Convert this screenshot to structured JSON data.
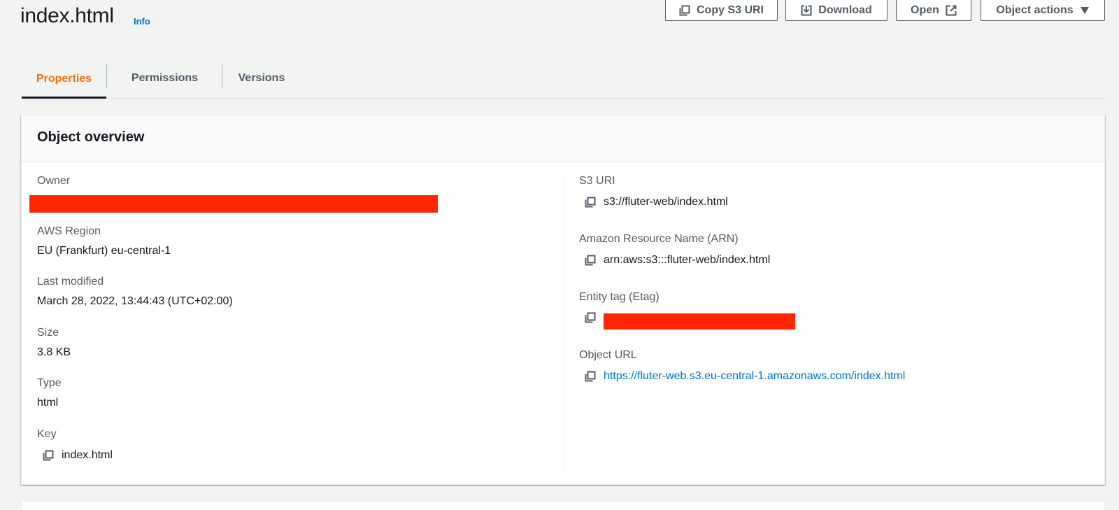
{
  "page": {
    "title": "index.html",
    "info_link": "Info"
  },
  "actions": {
    "copy_s3_uri": "Copy S3 URI",
    "download": "Download",
    "open": "Open",
    "object_actions": "Object actions"
  },
  "tabs": [
    {
      "label": "Properties",
      "active": true
    },
    {
      "label": "Permissions",
      "active": false
    },
    {
      "label": "Versions",
      "active": false
    }
  ],
  "overview": {
    "title": "Object overview",
    "left": {
      "owner": {
        "label": "Owner",
        "value": "[redacted]"
      },
      "region": {
        "label": "AWS Region",
        "value": "EU (Frankfurt) eu-central-1"
      },
      "last_modified": {
        "label": "Last modified",
        "value": "March 28, 2022, 13:44:43 (UTC+02:00)"
      },
      "size": {
        "label": "Size",
        "value": "3.8 KB"
      },
      "type": {
        "label": "Type",
        "value": "html"
      },
      "key": {
        "label": "Key",
        "value": "index.html"
      }
    },
    "right": {
      "s3_uri": {
        "label": "S3 URI",
        "value": "s3://fluter-web/index.html"
      },
      "arn": {
        "label": "Amazon Resource Name (ARN)",
        "value": "arn:aws:s3:::fluter-web/index.html"
      },
      "etag": {
        "label": "Entity tag (Etag)",
        "value": "[redacted]"
      },
      "object_url": {
        "label": "Object URL",
        "value": "https://fluter-web.s3.eu-central-1.amazonaws.com/index.html"
      }
    }
  },
  "colors": {
    "accent_tab": "#ec7211",
    "link": "#0073bb",
    "redaction": "#ff2600",
    "background": "#f2f3f3"
  }
}
